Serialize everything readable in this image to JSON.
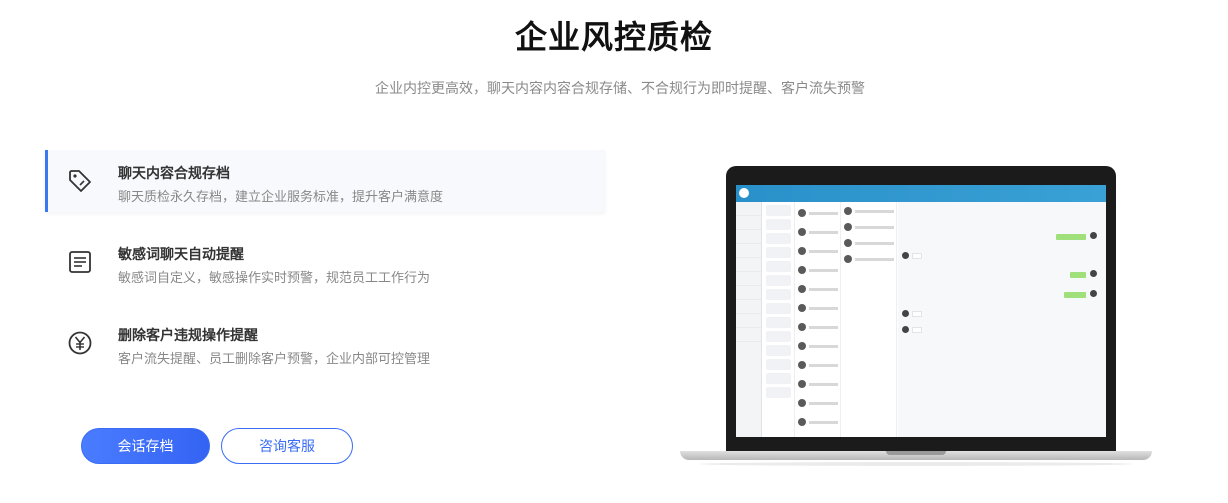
{
  "header": {
    "title": "企业风控质检",
    "subtitle": "企业内控更高效，聊天内容内容合规存储、不合规行为即时提醒、客户流失预警"
  },
  "features": [
    {
      "icon": "tag-icon",
      "title": "聊天内容合规存档",
      "desc": "聊天质检永久存档，建立企业服务标准，提升客户满意度",
      "active": true
    },
    {
      "icon": "document-icon",
      "title": "敏感词聊天自动提醒",
      "desc": "敏感词自定义，敏感操作实时预警，规范员工工作行为",
      "active": false
    },
    {
      "icon": "yuan-icon",
      "title": "删除客户违规操作提醒",
      "desc": "客户流失提醒、员工删除客户预警，企业内部可控管理",
      "active": false
    }
  ],
  "buttons": {
    "primary_label": "会话存档",
    "secondary_label": "咨询客服"
  },
  "colors": {
    "accent": "#3a6cf6",
    "title": "#111111",
    "muted": "#888888"
  }
}
